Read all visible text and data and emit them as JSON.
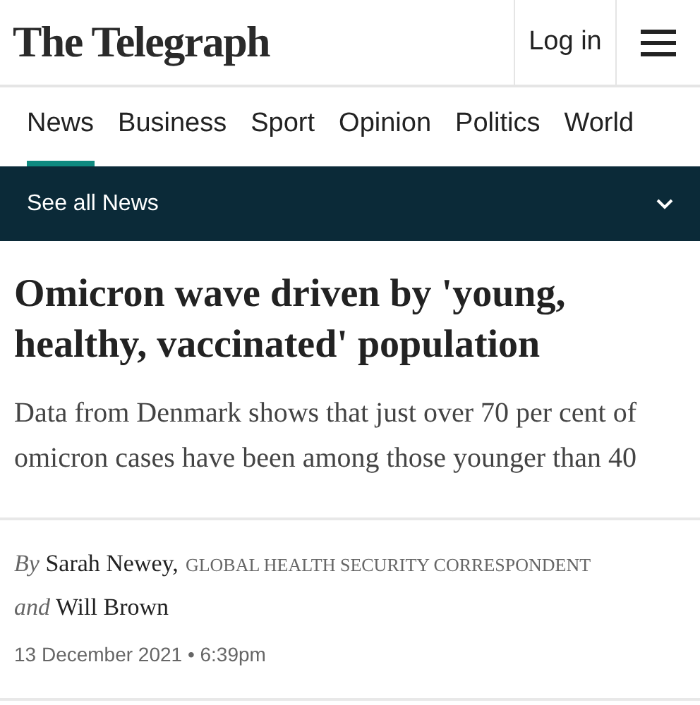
{
  "header": {
    "logo": "The Telegraph",
    "login": "Log in"
  },
  "nav": [
    {
      "label": "News",
      "selected": true
    },
    {
      "label": "Business",
      "selected": false
    },
    {
      "label": "Sport",
      "selected": false
    },
    {
      "label": "Opinion",
      "selected": false
    },
    {
      "label": "Politics",
      "selected": false
    },
    {
      "label": "World",
      "selected": false
    }
  ],
  "section_bar": {
    "label": "See all News",
    "expanded": false
  },
  "article": {
    "headline": "Omicron wave driven by 'young, healthy, vaccinated' population",
    "standfirst": "Data from Denmark shows that just over 70 per cent of omicron cases have been among those younger than 40",
    "byline": [
      {
        "author": "*By* Sarah Newey,",
        "role": "GLOBAL HEALTH SECURITY CORRESPONDENT"
      },
      {
        "author": "*and* Will Brown"
      }
    ],
    "date": "13 December 2021 • 6:39pm"
  }
}
